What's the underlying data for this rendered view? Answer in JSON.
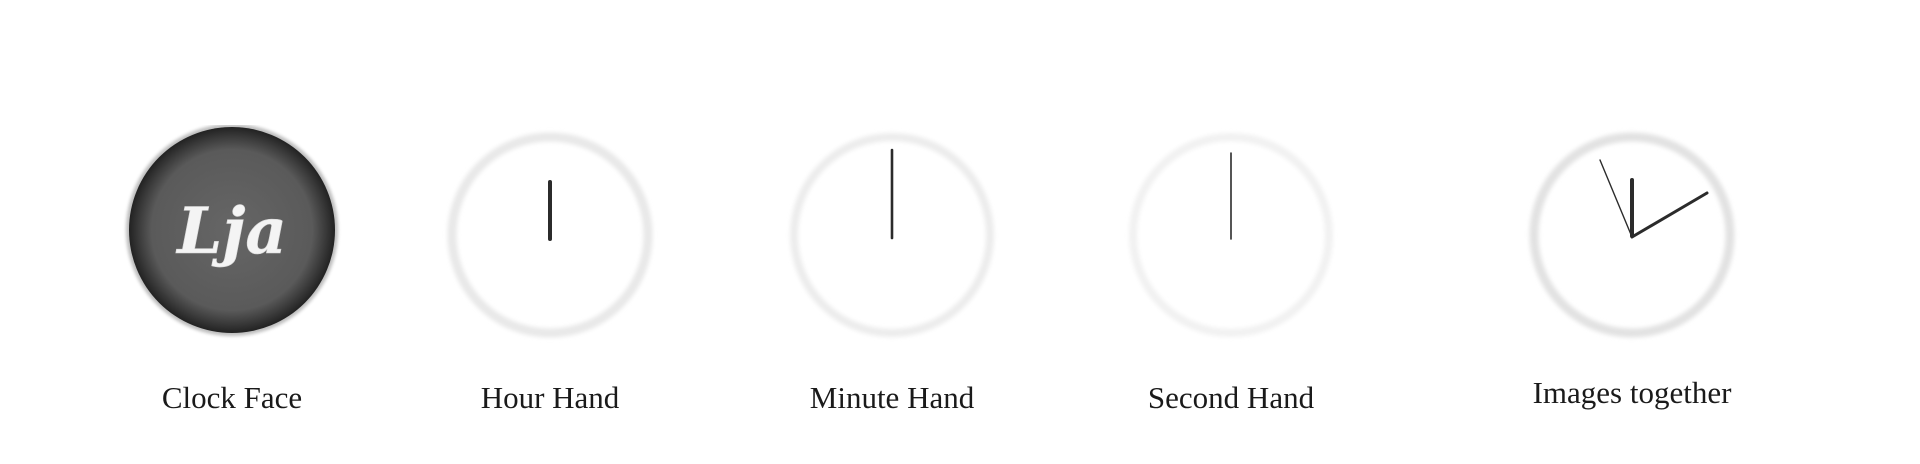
{
  "face_logo": "Lja",
  "panels": [
    {
      "key": "face",
      "caption": "Clock Face"
    },
    {
      "key": "hour",
      "caption": "Hour Hand"
    },
    {
      "key": "minute",
      "caption": "Minute Hand"
    },
    {
      "key": "second",
      "caption": "Second Hand"
    },
    {
      "key": "together",
      "caption": "Images together"
    }
  ],
  "colors": {
    "face_fill": "#5e5e5e",
    "face_rim": "#2e2e2e",
    "hand": "#2b2b2b",
    "ring": "#e6e6e6",
    "caption_text": "#1a1a1a"
  }
}
